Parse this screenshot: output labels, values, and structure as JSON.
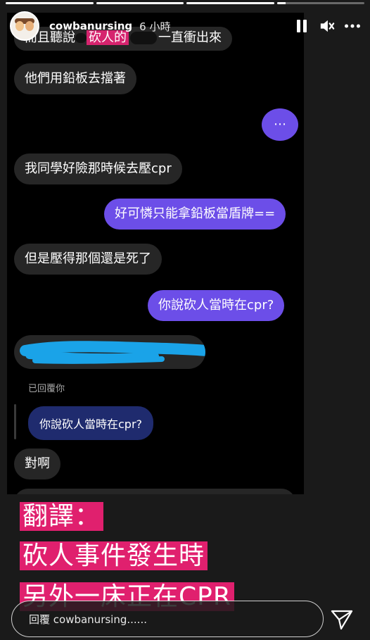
{
  "story": {
    "progress": [
      1,
      1,
      1,
      0.1
    ],
    "username": "cowbanursing",
    "time_ago": "6 小時",
    "icons": [
      "pause-icon",
      "mute-icon",
      "more-icon"
    ]
  },
  "chat": {
    "messages": [
      {
        "type": "received",
        "before": "而且聽說",
        "highlight": "砍人的",
        "after": "一直衝出來"
      },
      {
        "type": "received",
        "text": "他們用鉛板去擋著"
      },
      {
        "type": "sent",
        "text": "⋯"
      },
      {
        "type": "received",
        "text": "我同學好險那時候去壓cpr"
      },
      {
        "type": "sent",
        "text": "好可憐只能拿鉛板當盾牌=="
      },
      {
        "type": "received",
        "text": "但是壓得那個還是死了"
      },
      {
        "type": "sent",
        "text": "你說砍人當時在cpr?"
      },
      {
        "type": "received",
        "text": "對啊"
      }
    ],
    "replied_label": "已回覆你",
    "reply_quote": "你說砍人當時在cpr?"
  },
  "translation": {
    "line1": "翻譯：",
    "line2": "砍人事件發生時",
    "line3": "另外一床正在CPR"
  },
  "reply_box": {
    "placeholder": "回覆 cowbanursing......"
  },
  "colors": {
    "sent_bubble": "#6c4ee8",
    "received_bubble": "#262626",
    "highlight": "#e0206e",
    "scribble": "#1aa3e8",
    "reply_bubble": "#1f2b6e"
  }
}
